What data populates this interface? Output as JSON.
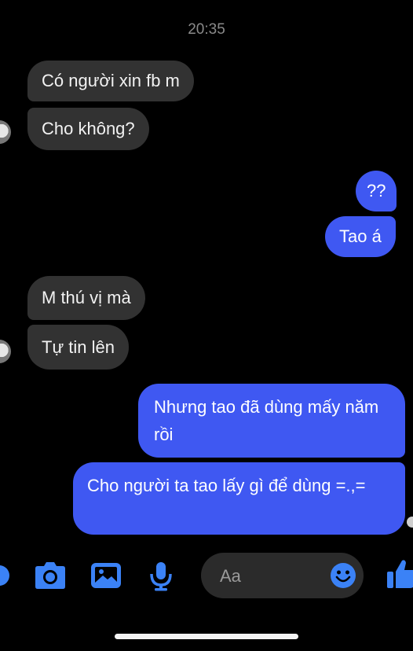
{
  "chat": {
    "timestamp": "20:35",
    "messages": [
      {
        "from": "them",
        "text": "Có người xin fb m"
      },
      {
        "from": "them",
        "text": "Cho không?"
      },
      {
        "from": "me",
        "text": "??"
      },
      {
        "from": "me",
        "text": "Tao á"
      },
      {
        "from": "them",
        "text": "M thú vị mà"
      },
      {
        "from": "them",
        "text": "Tự tin lên"
      },
      {
        "from": "me",
        "text": "Nhưng tao đã dùng mấy năm rồi"
      },
      {
        "from": "me",
        "text": "Cho người ta tao lấy gì để dùng =.,="
      }
    ]
  },
  "composer": {
    "placeholder": "Aa"
  },
  "toolbar": {
    "icons": [
      "more-icon",
      "camera-icon",
      "gallery-icon",
      "microphone-icon",
      "emoji-icon",
      "thumbs-up-icon"
    ]
  },
  "colors": {
    "background": "#000000",
    "incoming_bubble": "#323232",
    "outgoing_bubble": "#3f58f2",
    "accent": "#3b82f6"
  }
}
